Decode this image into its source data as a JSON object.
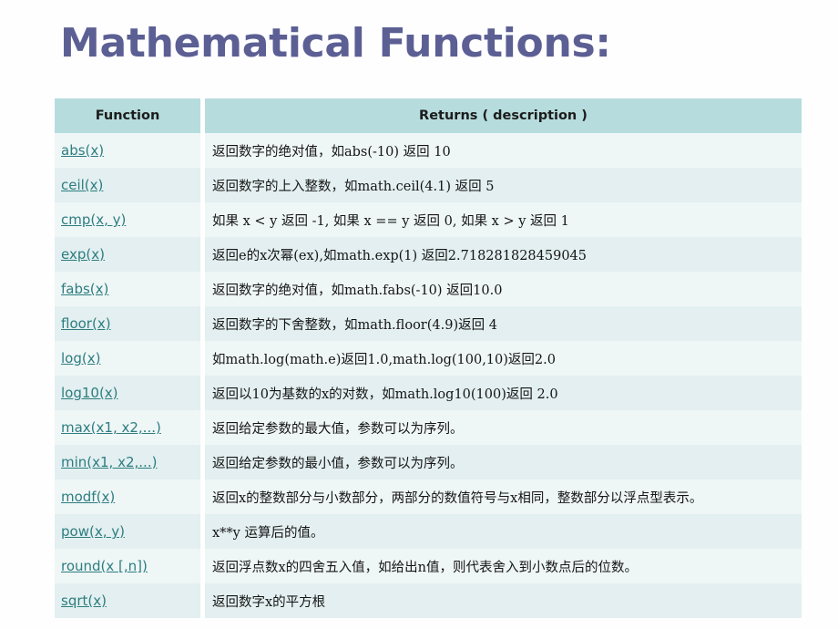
{
  "slide": {
    "title": "Mathematical Functions:",
    "title_color": "#5c5f93",
    "background_color": "#fefeff"
  },
  "table": {
    "header_bg": "#b6dcdd",
    "row_bg_odd": "#eff6f6",
    "row_bg_even": "#e3eff0",
    "link_color": "#2d7d80",
    "columns": [
      "Function",
      "Returns ( description )"
    ],
    "rows": [
      {
        "function": "abs(x)",
        "description": "返回数字的绝对值，如abs(-10) 返回 10"
      },
      {
        "function": "ceil(x)",
        "description": "返回数字的上入整数，如math.ceil(4.1) 返回 5"
      },
      {
        "function": "cmp(x, y)",
        "description": "如果 x < y 返回 -1, 如果 x == y 返回 0, 如果 x > y 返回 1"
      },
      {
        "function": "exp(x)",
        "description": "返回e的x次幂(ex),如math.exp(1) 返回2.718281828459045"
      },
      {
        "function": "fabs(x)",
        "description": "返回数字的绝对值，如math.fabs(-10) 返回10.0"
      },
      {
        "function": "floor(x)",
        "description": "返回数字的下舍整数，如math.floor(4.9)返回 4"
      },
      {
        "function": "log(x)",
        "description": "如math.log(math.e)返回1.0,math.log(100,10)返回2.0"
      },
      {
        "function": "log10(x)",
        "description": "返回以10为基数的x的对数，如math.log10(100)返回 2.0"
      },
      {
        "function": "max(x1, x2,...)",
        "description": "返回给定参数的最大值，参数可以为序列。"
      },
      {
        "function": "min(x1, x2,...)",
        "description": "返回给定参数的最小值，参数可以为序列。"
      },
      {
        "function": "modf(x)",
        "description": "返回x的整数部分与小数部分，两部分的数值符号与x相同，整数部分以浮点型表示。"
      },
      {
        "function": "pow(x, y)",
        "description": "x**y 运算后的值。"
      },
      {
        "function": "round(x [,n])",
        "description": "返回浮点数x的四舍五入值，如给出n值，则代表舍入到小数点后的位数。"
      },
      {
        "function": "sqrt(x)",
        "description": "返回数字x的平方根"
      }
    ]
  }
}
